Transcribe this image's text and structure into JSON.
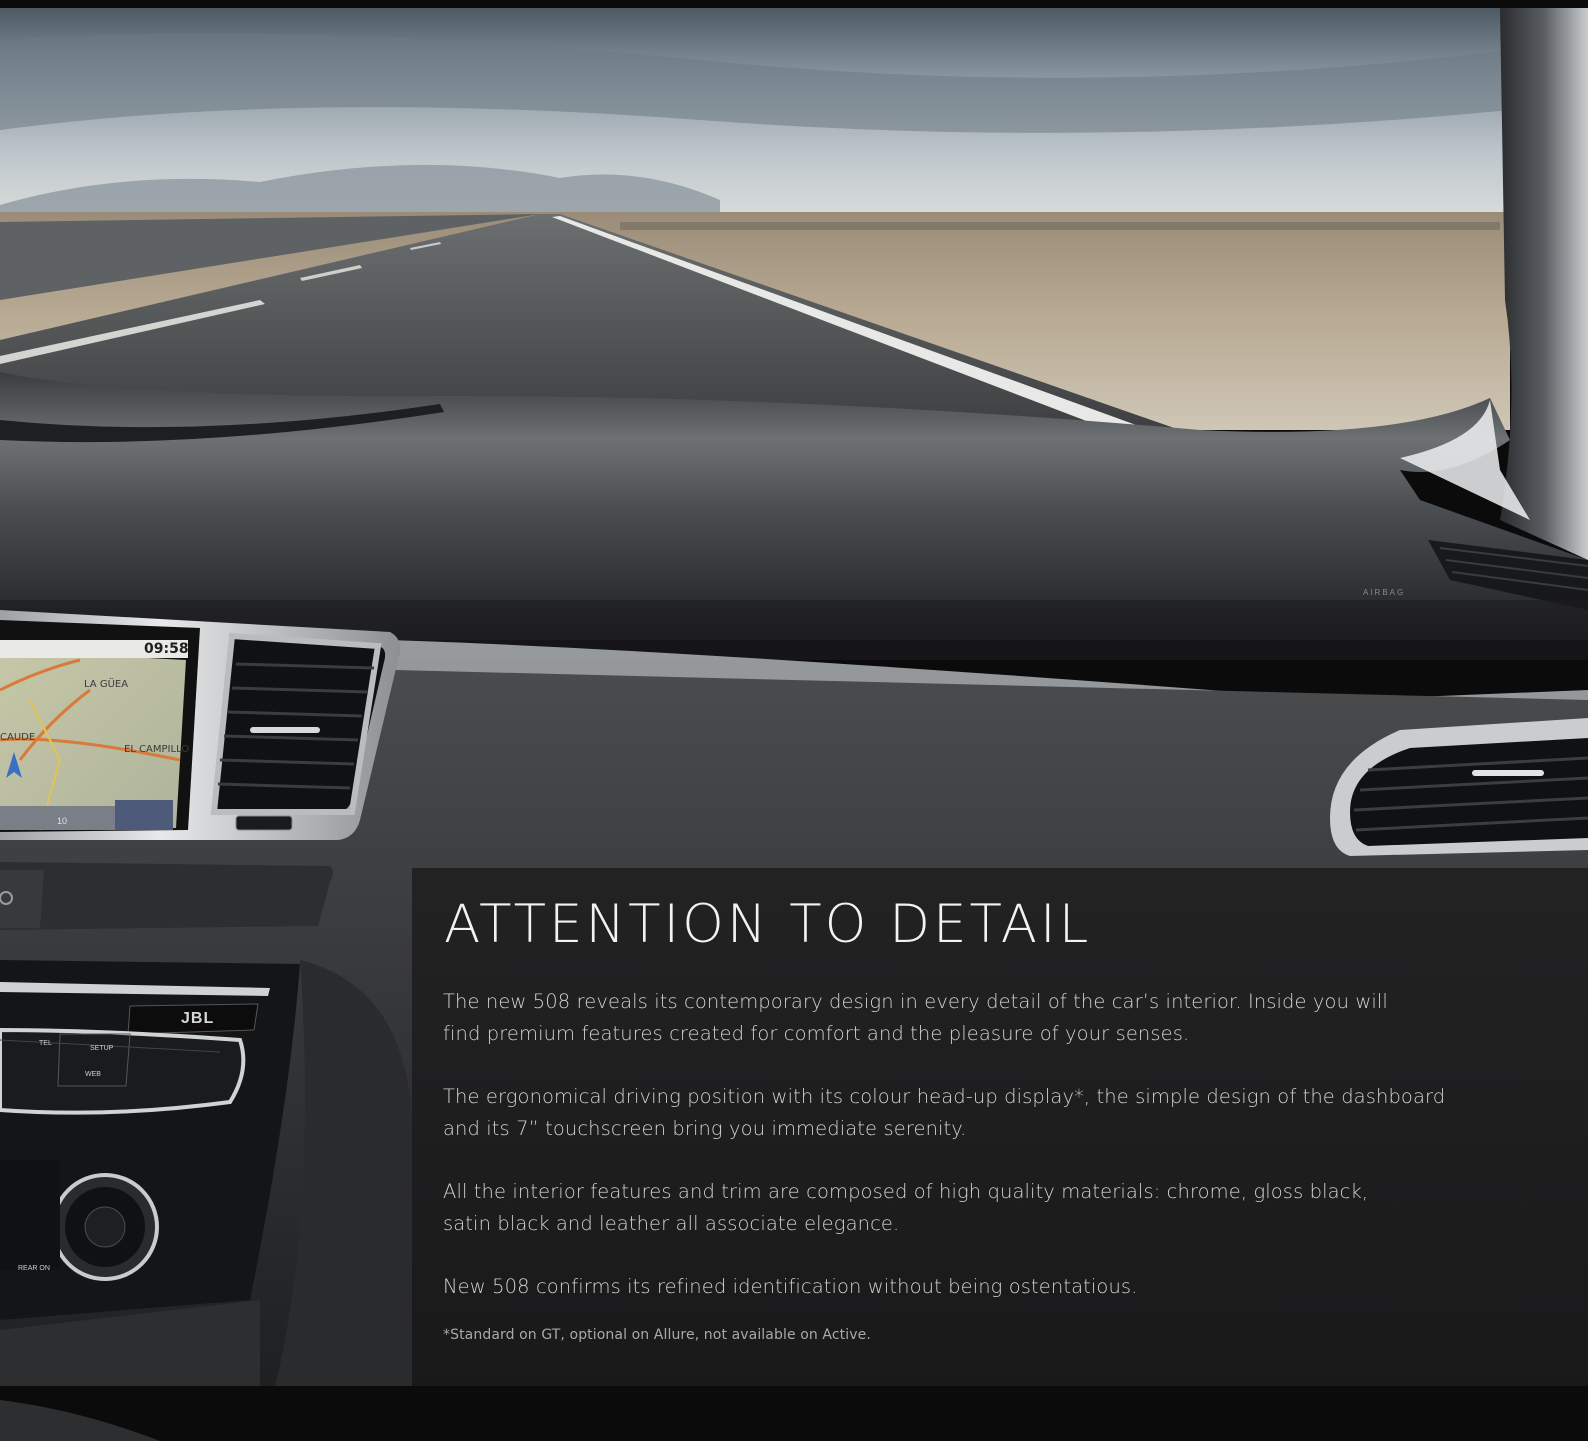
{
  "scene": {
    "description_icon": "car-interior-dashboard-photo",
    "nav_screen": {
      "time": "09:58",
      "places": [
        "LA GÜEA",
        "CAUDE",
        "EL CAMPILLO"
      ],
      "scale": "10"
    },
    "console_buttons": [
      "TEL",
      "SETUP",
      "WEB",
      "REAR ON"
    ],
    "brand_badge": "JBL",
    "airbag_label": "AIRBAG"
  },
  "panel": {
    "title": "ATTENTION TO DETAIL",
    "paragraphs": [
      "The new 508 reveals its contemporary design in every detail of the car’s interior. Inside you will find premium features created for comfort and the pleasure of your senses.",
      "The ergonomical driving position with its colour head-up display*, the simple design of the dashboard and its 7” touchscreen bring you immediate serenity.",
      "All the interior features and trim are composed of high quality materials: chrome, gloss black, satin black and leather all associate elegance.",
      "New 508 confirms its refined identification without being ostentatious."
    ],
    "footnote": "*Standard on GT, optional on Allure, not available on Active."
  },
  "colors": {
    "panel_bg": "#222122",
    "title_text": "#f2f2f2",
    "body_text": "#d2d2d2",
    "footnote_text": "#a9a9a9"
  }
}
